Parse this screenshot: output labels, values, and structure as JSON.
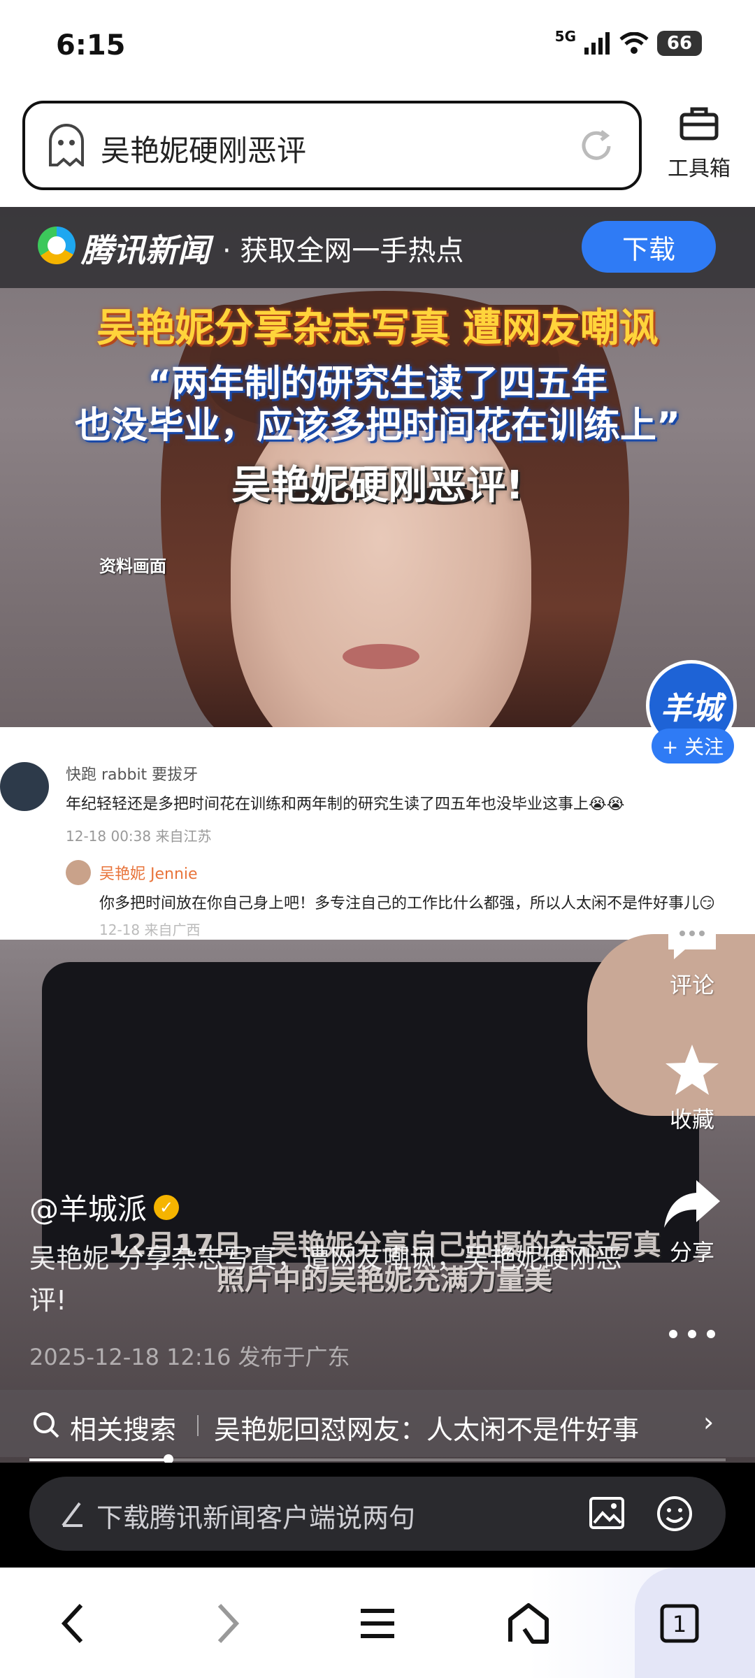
{
  "status_bar": {
    "time": "6:15",
    "network": "5G",
    "battery": "66"
  },
  "url_bar": {
    "query": "吴艳妮硬刚恶评"
  },
  "toolbox": {
    "label": "工具箱"
  },
  "banner": {
    "brand": "腾讯新闻",
    "slogan": "· 获取全网一手热点",
    "download": "下载"
  },
  "video": {
    "headline_line1": "吴艳妮分享杂志写真 遭网友嘲讽",
    "headline_line2": "“两年制的研究生读了四五年",
    "headline_line3": "也没毕业，应该多把时间花在训练上”",
    "headline_line4": "吴艳妮硬刚恶评!",
    "archive_label": "资料画面",
    "caption_line1": "12月17日，吴艳妮分享自己拍摄的杂志写真",
    "caption_line2": "照片中的吴艳妮充满力量美",
    "comments": [
      {
        "user": "快跑 rabbit 要拔牙",
        "text": "年纪轻轻还是多把时间花在训练和两年制的研究生读了四五年也没毕业这事上😭😭",
        "meta": "12-18 00:38 来自江苏"
      },
      {
        "user": "吴艳妮 Jennie",
        "text": "你多把时间放在你自己身上吧！多专注自己的工作比什么都强，所以人太闲不是件好事儿😏",
        "meta": "12-18 来自广西"
      }
    ]
  },
  "side": {
    "account_avatar": "羊城",
    "follow": "+ 关注",
    "comment": "评论",
    "favorite": "收藏",
    "share": "分享"
  },
  "post": {
    "author": "@羊城派",
    "description": "吴艳妮 分享杂志写真，遭网友嘲讽，吴艳妮硬刚恶评!",
    "timestamp": "2025-12-18 12:16 发布于广东"
  },
  "related": {
    "label": "相关搜索",
    "query": "吴艳妮回怼网友：人太闲不是件好事"
  },
  "progress": {
    "fraction": 0.2
  },
  "comment_input": {
    "placeholder": "下载腾讯新闻客户端说两句"
  },
  "navbar": {
    "tab_count": "1"
  },
  "colors": {
    "accent": "#2f7bf5",
    "headline_yellow": "#ffd43b",
    "verified": "#f5b400"
  }
}
